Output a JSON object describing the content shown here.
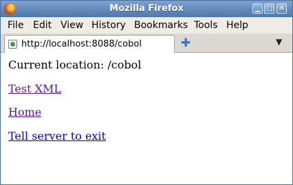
{
  "window": {
    "title": "Mozilla Firefox"
  },
  "menu": [
    "File",
    "Edit",
    "View",
    "History",
    "Bookmarks",
    "Tools",
    "Help"
  ],
  "tab": {
    "title": "http://localhost:8088/cobol"
  },
  "page": {
    "location": "Current location: /cobol",
    "links": [
      "Test XML",
      "Home",
      "Tell server to exit"
    ]
  },
  "colors": {
    "visited_link": "#551a8b",
    "link": "#0000ee",
    "titlebar": "#5a80b3"
  },
  "icons": [
    "firefox-logo-icon",
    "minimize-icon",
    "maximize-icon",
    "close-icon",
    "page-favicon-icon",
    "new-tab-icon",
    "tab-list-chevron-icon"
  ]
}
